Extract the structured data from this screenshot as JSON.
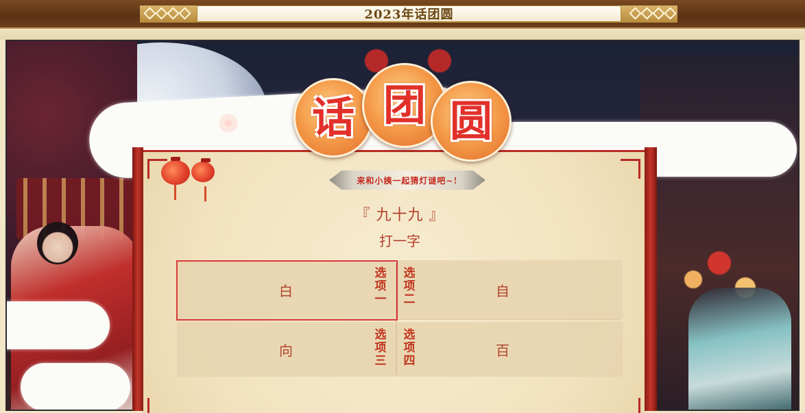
{
  "window": {
    "title": "2023年话团圆"
  },
  "event": {
    "logo_chars": [
      "话",
      "团",
      "圆"
    ],
    "subtitle": "来和小姨一起猜灯谜吧~!"
  },
  "riddle": {
    "question": "『 九十九 』",
    "hint": "打一字"
  },
  "options": [
    {
      "tag": "选项一",
      "value": "白",
      "selected": true
    },
    {
      "tag": "选项二",
      "value": "自",
      "selected": false
    },
    {
      "tag": "选项三",
      "value": "向",
      "selected": false
    },
    {
      "tag": "选项四",
      "value": "百",
      "selected": false
    }
  ],
  "colors": {
    "accent_red": "#c62a20",
    "text_brown": "#b0452c",
    "paper": "#f2e2bf",
    "selection_outline": "#d93a3a"
  }
}
